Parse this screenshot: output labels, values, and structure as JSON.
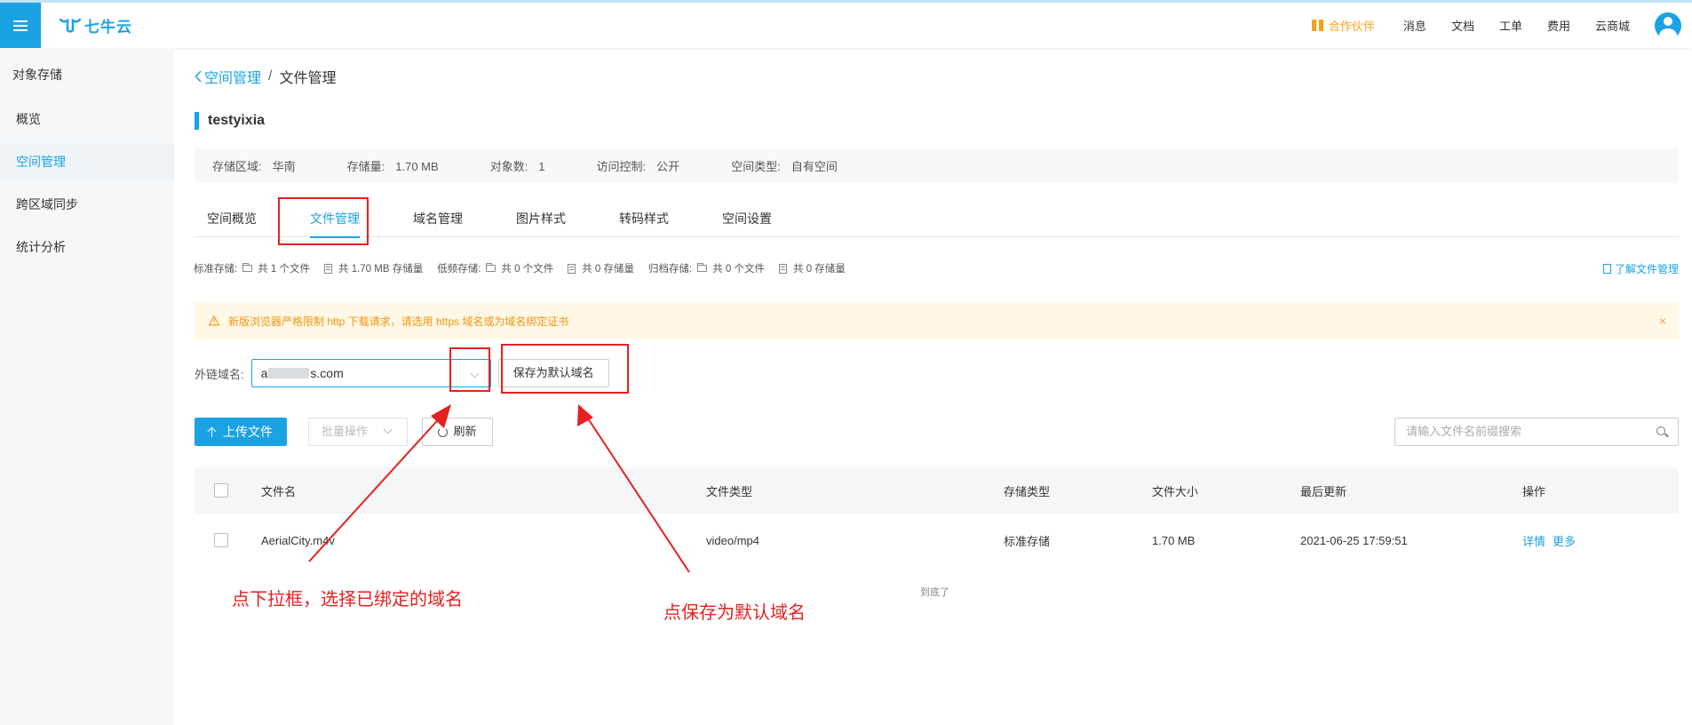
{
  "app": {
    "logo_text": "七牛云",
    "nav": [
      "消息",
      "文档",
      "工单",
      "费用",
      "云商城"
    ],
    "partner": "合作伙伴"
  },
  "sidebar": {
    "title": "对象存储",
    "items": [
      {
        "label": "概览",
        "active": false
      },
      {
        "label": "空间管理",
        "active": true
      },
      {
        "label": "跨区域同步",
        "active": false
      },
      {
        "label": "统计分析",
        "active": false
      }
    ]
  },
  "breadcrumb": {
    "back": "空间管理",
    "separator": "/",
    "current": "文件管理"
  },
  "bucket": {
    "name": "testyixia",
    "info": [
      {
        "key": "存储区域:",
        "value": "华南"
      },
      {
        "key": "存储量:",
        "value": "1.70 MB"
      },
      {
        "key": "对象数:",
        "value": "1"
      },
      {
        "key": "访问控制:",
        "value": "公开"
      },
      {
        "key": "空间类型:",
        "value": "自有空间"
      }
    ]
  },
  "tabs": [
    {
      "label": "空间概览",
      "active": false
    },
    {
      "label": "文件管理",
      "active": true
    },
    {
      "label": "域名管理",
      "active": false
    },
    {
      "label": "图片样式",
      "active": false
    },
    {
      "label": "转码样式",
      "active": false
    },
    {
      "label": "空间设置",
      "active": false
    }
  ],
  "stats": {
    "standard_label": "标准存储:",
    "standard_files": "共 1 个文件",
    "standard_size": "共 1.70 MB 存储量",
    "low_label": "低频存储:",
    "low_files": "共 0 个文件",
    "low_size": "共 0 存储量",
    "archive_label": "归档存储:",
    "archive_files": "共 0 个文件",
    "archive_size": "共 0 存储量",
    "learn_more": "了解文件管理"
  },
  "notice": {
    "text": "新版浏览器严格限制 http 下载请求，请选用 https 域名或为域名绑定证书",
    "close": "×"
  },
  "domain": {
    "label": "外链域名:",
    "value_prefix": "a",
    "value_suffix": "s.com",
    "save_button": "保存为默认域名"
  },
  "actions": {
    "upload": "上传文件",
    "batch": "批量操作",
    "refresh": "刷新",
    "search_placeholder": "请输入文件名前缀搜索"
  },
  "table": {
    "headers": [
      "文件名",
      "文件类型",
      "存储类型",
      "文件大小",
      "最后更新",
      "操作"
    ],
    "rows": [
      {
        "name": "AerialCity.m4v",
        "type": "video/mp4",
        "storage": "标准存储",
        "size": "1.70 MB",
        "updated": "2021-06-25 17:59:51",
        "op_detail": "详情",
        "op_more": "更多"
      }
    ],
    "end_note": "到底了"
  },
  "annotations": {
    "left_text": "点下拉框，选择已绑定的域名",
    "right_text": "点保存为默认域名",
    "color": "#e52020"
  },
  "colors": {
    "accent": "#1ba2e3",
    "warning": "#f19414"
  }
}
